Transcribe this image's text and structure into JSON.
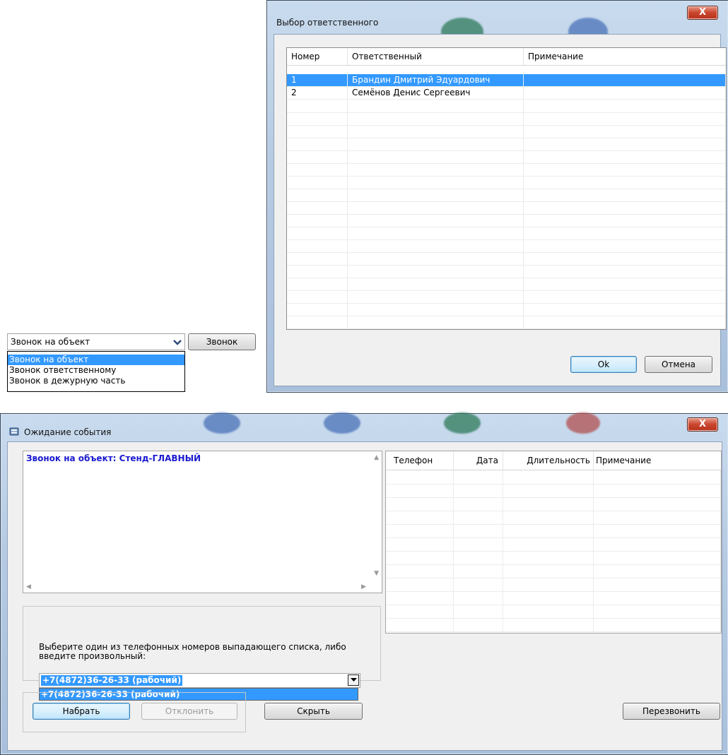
{
  "call_type": {
    "selected": "Звонок на объект",
    "options": [
      "Звонок на объект",
      "Звонок ответственному",
      "Звонок в дежурную часть"
    ],
    "call_button": "Звонок"
  },
  "select_responsible": {
    "title": "Выбор ответственного",
    "close": "X",
    "columns": [
      "Номер",
      "Ответственный",
      "Примечание"
    ],
    "rows": [
      {
        "num": "1",
        "name": "Брандин Дмитрий Эдуардович",
        "note": ""
      },
      {
        "num": "2",
        "name": "Семёнов Денис Сергеевич",
        "note": ""
      }
    ],
    "ok": "Ok",
    "cancel": "Отмена"
  },
  "wait_event": {
    "title": "Ожидание события",
    "close": "X",
    "event_text": "Звонок на объект: Стенд-ГЛАВНЫЙ",
    "hint": "Выберите один из телефонных номеров выпадающего списка, либо введите произвольный:",
    "phone_value": "+7(4872)36-26-33 (рабочий)",
    "phone_options": [
      "+7(4872)36-26-33 (рабочий)"
    ],
    "log_columns": [
      "Телефон",
      "Дата",
      "Длительность",
      "Примечание"
    ],
    "dial": "Набрать",
    "reject": "Отклонить",
    "hide": "Скрыть",
    "callback": "Перезвонить"
  },
  "colors": {
    "selection": "#3399ff",
    "event_text": "#1a1ad0",
    "close_button": "#c9452e"
  }
}
